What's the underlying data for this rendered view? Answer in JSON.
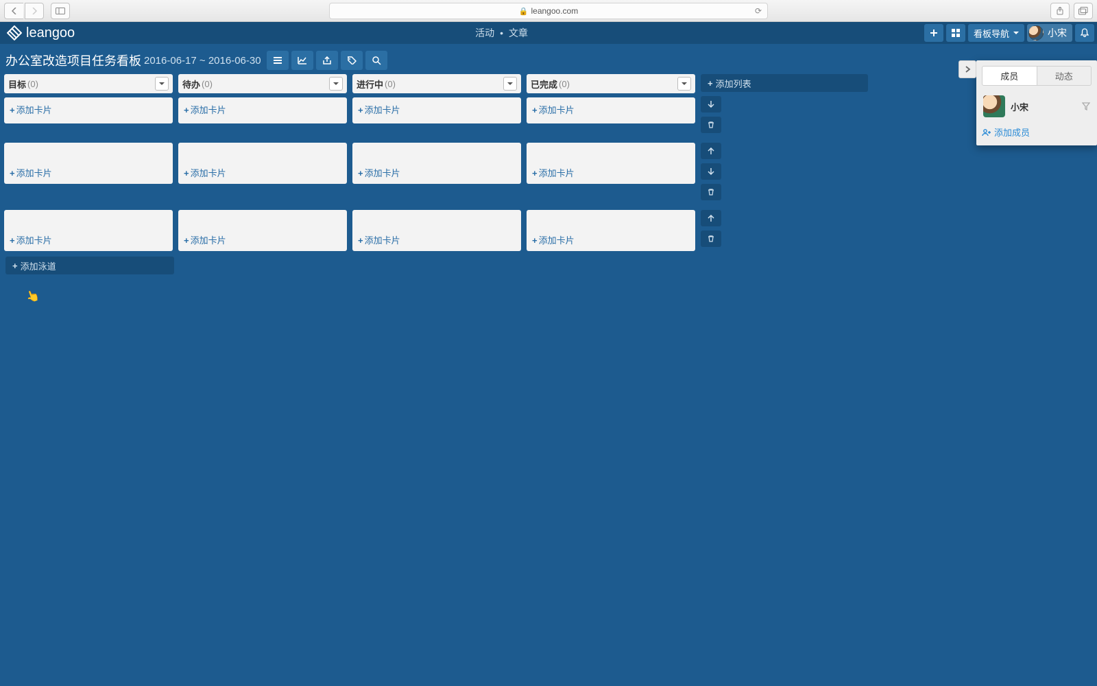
{
  "browser": {
    "url": "leangoo.com"
  },
  "app": {
    "brand": "leangoo",
    "nav": {
      "activity": "活动",
      "article": "文章"
    },
    "board_nav_label": "看板导航",
    "user_name": "小宋"
  },
  "board": {
    "title": "办公室改造项目任务看板",
    "date_range": "2016-06-17 ~ 2016-06-30",
    "columns": [
      {
        "name": "目标",
        "count": "(0)"
      },
      {
        "name": "待办",
        "count": "(0)"
      },
      {
        "name": "进行中",
        "count": "(0)"
      },
      {
        "name": "已完成",
        "count": "(0)"
      }
    ],
    "add_card_label": "添加卡片",
    "add_list_label": "添加列表",
    "add_lane_label": "添加泳道"
  },
  "side_panel": {
    "tabs": {
      "members": "成员",
      "activity": "动态"
    },
    "member_name": "小宋",
    "add_member_label": "添加成员"
  }
}
